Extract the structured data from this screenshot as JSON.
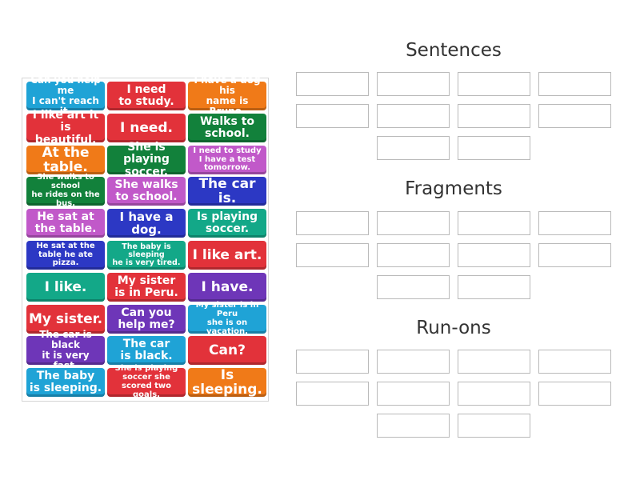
{
  "groups": [
    {
      "title": "Sentences"
    },
    {
      "title": "Fragments"
    },
    {
      "title": "Run-ons"
    }
  ],
  "cards": [
    {
      "label": "Can you help me\nI can't reach it.",
      "color": "#1fa3d6",
      "size": "s"
    },
    {
      "label": "I need\nto study.",
      "color": "#e2323a",
      "size": "m"
    },
    {
      "label": "I have a dog his\nname is Bruno.",
      "color": "#f07a18",
      "size": "s"
    },
    {
      "label": "I like art it\nis beautiful.",
      "color": "#e2323a",
      "size": "m"
    },
    {
      "label": "I need.",
      "color": "#e2323a",
      "size": "l"
    },
    {
      "label": "Walks to\nschool.",
      "color": "#12813b",
      "size": "m"
    },
    {
      "label": "At the table.",
      "color": "#f07a18",
      "size": "l"
    },
    {
      "label": "She is playing\nsoccer.",
      "color": "#12813b",
      "size": "m"
    },
    {
      "label": "I need to study\nI have a test\ntomorrow.",
      "color": "#c159c9",
      "size": "xs"
    },
    {
      "label": "She walks to school\nhe rides on the bus.",
      "color": "#12813b",
      "size": "xs"
    },
    {
      "label": "She walks\nto school.",
      "color": "#c159c9",
      "size": "m"
    },
    {
      "label": "The car is.",
      "color": "#2c38c4",
      "size": "l"
    },
    {
      "label": "He sat at\nthe table.",
      "color": "#c159c9",
      "size": "m"
    },
    {
      "label": "I have a dog.",
      "color": "#2c38c4",
      "size": "ml"
    },
    {
      "label": "Is playing\nsoccer.",
      "color": "#13a888",
      "size": "m"
    },
    {
      "label": "He sat at the\ntable he ate pizza.",
      "color": "#2c38c4",
      "size": "xs"
    },
    {
      "label": "The baby is sleeping\nhe is very tired.",
      "color": "#13a888",
      "size": "xxs"
    },
    {
      "label": "I like art.",
      "color": "#e2323a",
      "size": "l"
    },
    {
      "label": "I like.",
      "color": "#13a888",
      "size": "l"
    },
    {
      "label": "My sister\nis in Peru.",
      "color": "#e2323a",
      "size": "m"
    },
    {
      "label": "I have.",
      "color": "#6e36b8",
      "size": "l"
    },
    {
      "label": "My sister.",
      "color": "#e2323a",
      "size": "l"
    },
    {
      "label": "Can you\nhelp me?",
      "color": "#6e36b8",
      "size": "m"
    },
    {
      "label": "My sister is in Peru\nshe is on vacation.",
      "color": "#1fa3d6",
      "size": "xs"
    },
    {
      "label": "The car is black\nit is very fast.",
      "color": "#6e36b8",
      "size": "s"
    },
    {
      "label": "The car\nis black.",
      "color": "#1fa3d6",
      "size": "m"
    },
    {
      "label": "Can?",
      "color": "#e2323a",
      "size": "l"
    },
    {
      "label": "The baby\nis sleeping.",
      "color": "#1fa3d6",
      "size": "m"
    },
    {
      "label": "She is playing\nsoccer she\nscored two goals.",
      "color": "#e2323a",
      "size": "xs"
    },
    {
      "label": "Is sleeping.",
      "color": "#f07a18",
      "size": "l"
    }
  ]
}
